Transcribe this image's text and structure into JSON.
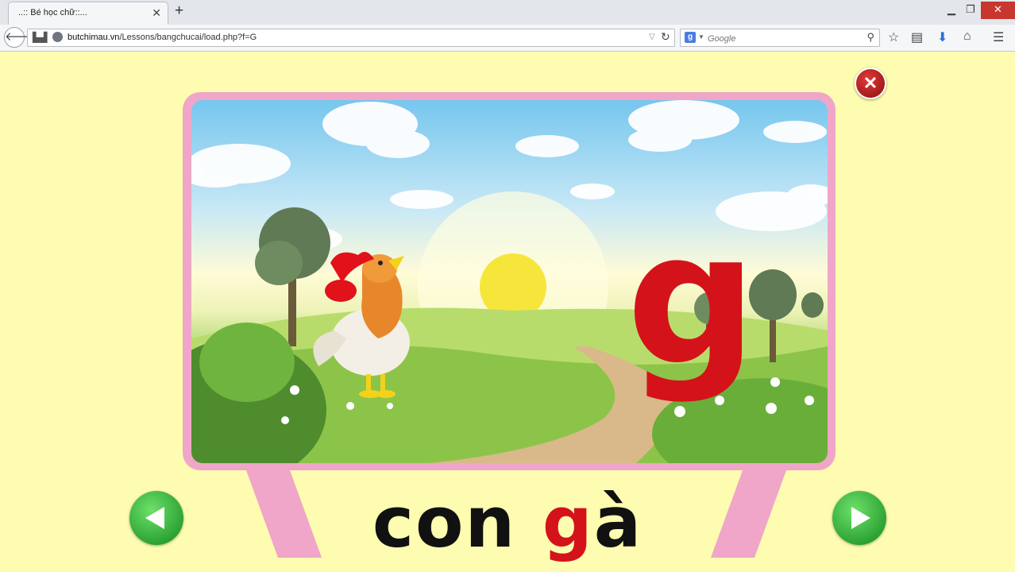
{
  "browser": {
    "tab_title": "..:: Bé học chữ::...",
    "url_domain": "butchimau.vn",
    "url_path": "/Lessons/bangchucai/load.php?f=G",
    "search_placeholder": "Google"
  },
  "icons": {
    "tab_close": "close-icon",
    "new_tab": "plus-icon",
    "back": "back-arrow-icon",
    "reload": "reload-icon",
    "bookmark": "star-icon",
    "reading_list": "clipboard-icon",
    "download": "download-arrow-icon",
    "home": "home-icon",
    "menu": "hamburger-menu-icon"
  },
  "lesson": {
    "letter": "g",
    "word_part1": "con ",
    "word_highlight": "g",
    "word_part2": "à"
  },
  "colors": {
    "background": "#fdfcb0",
    "frame": "#f0a6c8",
    "letter": "#d4121a",
    "nav_button": "#2aa52f",
    "close_button": "#a51414"
  }
}
